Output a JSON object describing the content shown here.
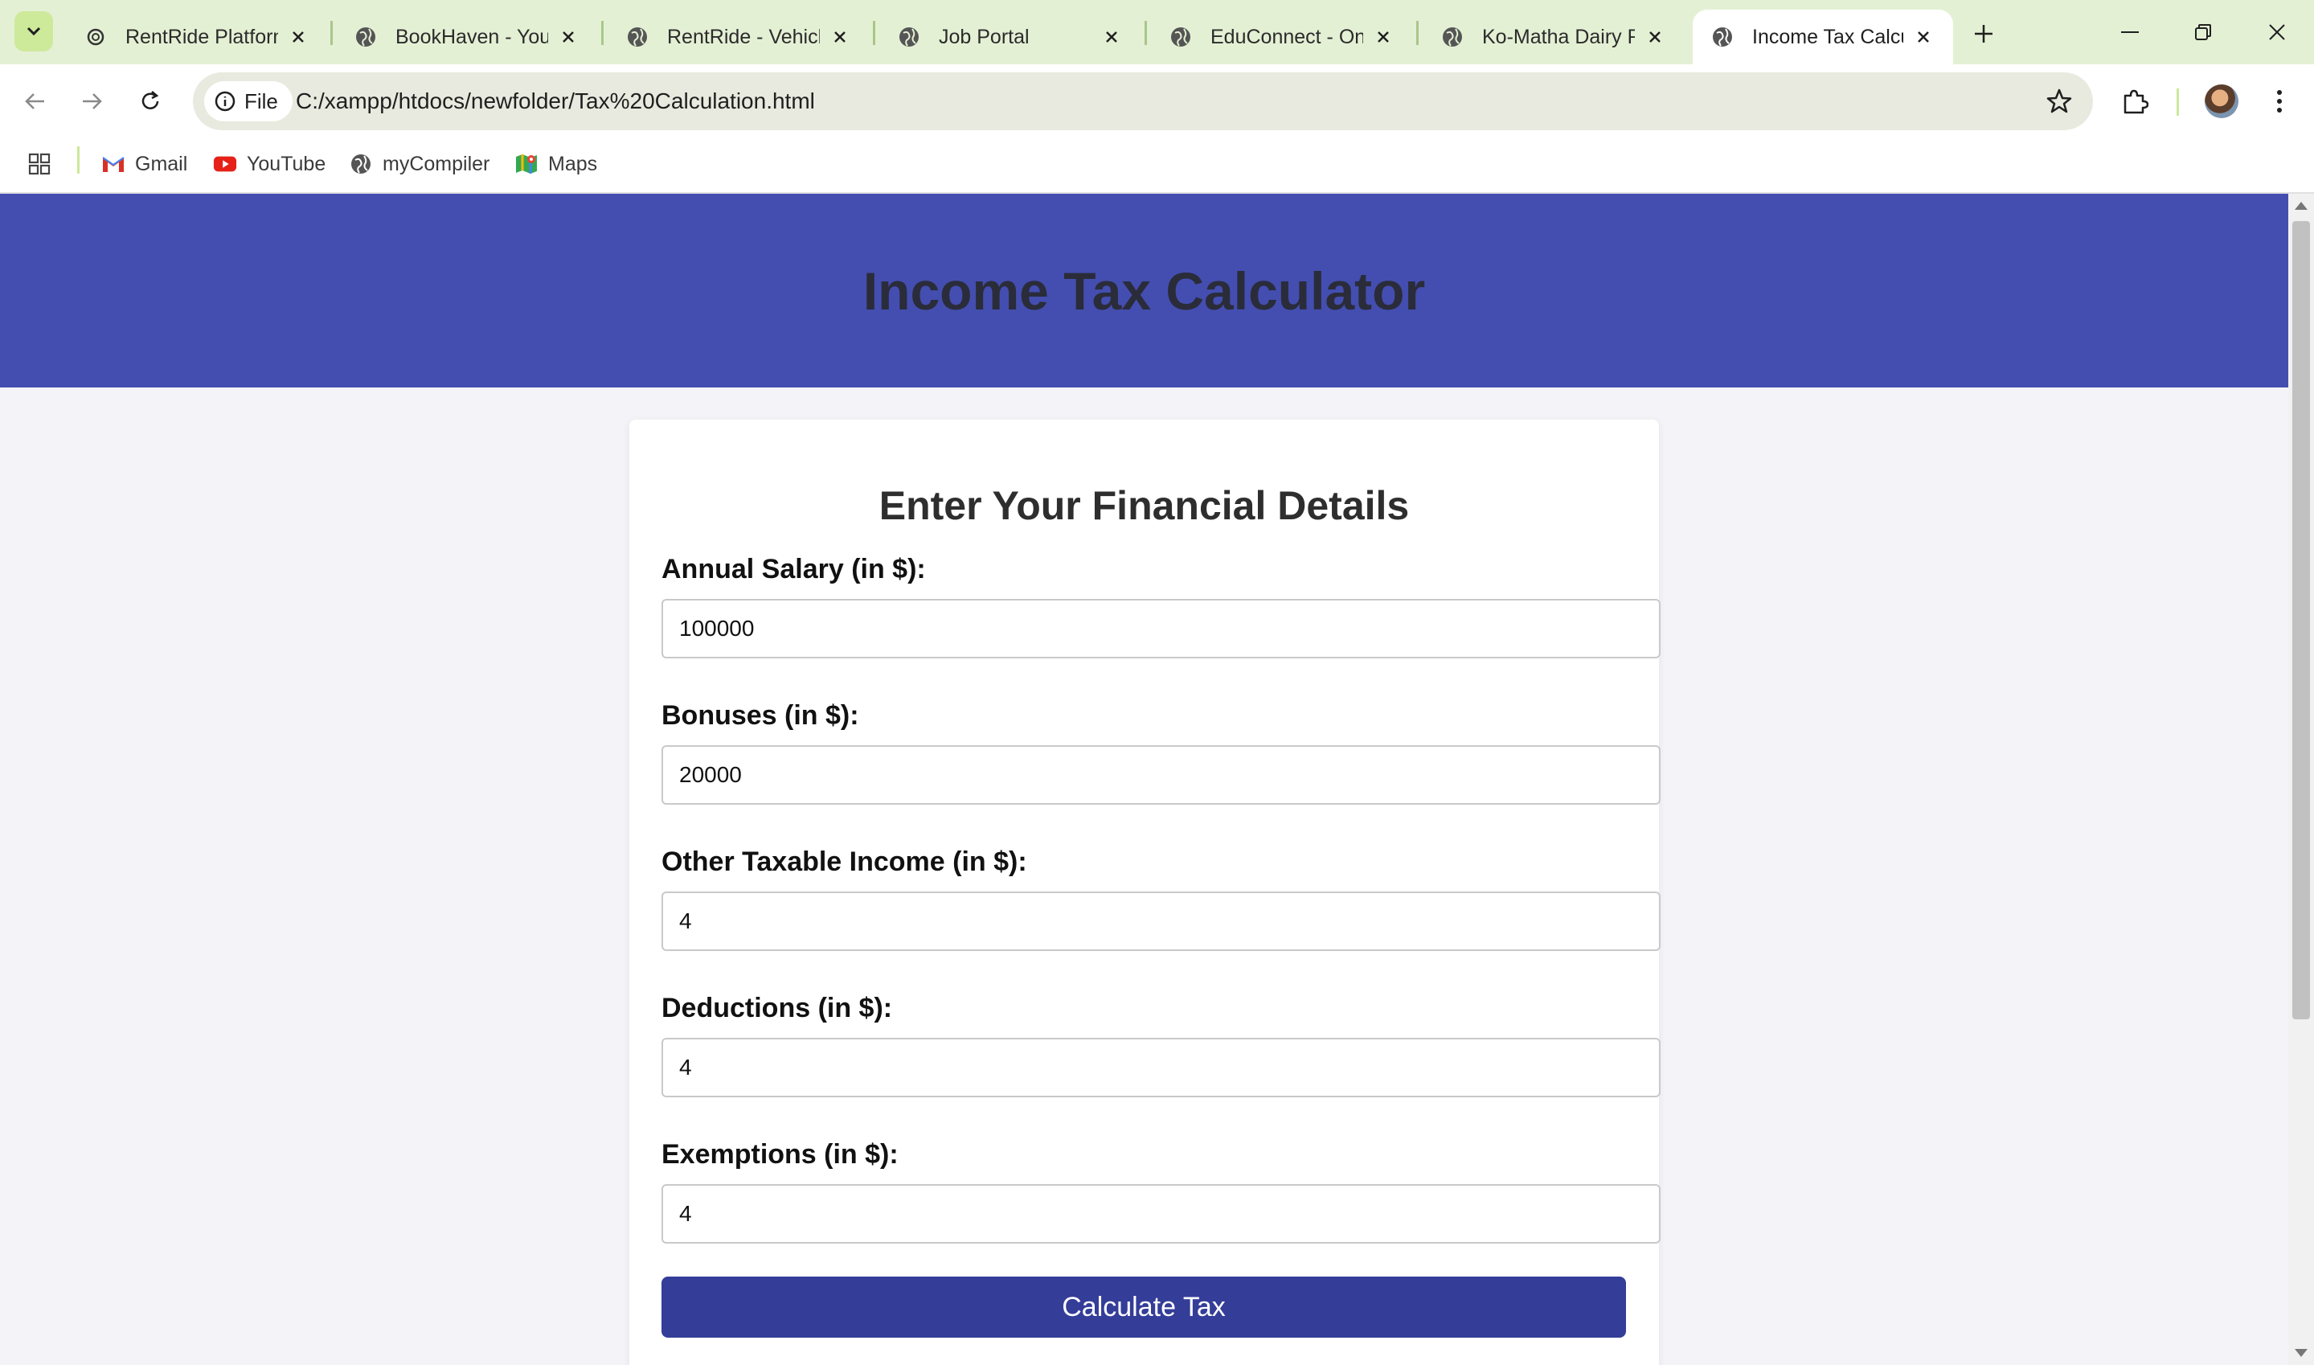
{
  "browser": {
    "tabs": [
      {
        "title": "RentRide Platform",
        "icon": "openai-icon",
        "active": false
      },
      {
        "title": "BookHaven - Your",
        "icon": "globe-icon",
        "active": false
      },
      {
        "title": "RentRide - Vehicle",
        "icon": "globe-icon",
        "active": false
      },
      {
        "title": "Job Portal",
        "icon": "globe-icon",
        "active": false
      },
      {
        "title": "EduConnect - Onli",
        "icon": "globe-icon",
        "active": false
      },
      {
        "title": "Ko-Matha Dairy Fa",
        "icon": "globe-icon",
        "active": false
      },
      {
        "title": "Income Tax Calcul",
        "icon": "globe-icon",
        "active": true
      }
    ],
    "address": {
      "chip_label": "File",
      "url": "C:/xampp/htdocs/newfolder/Tax%20Calculation.html"
    },
    "bookmarks": [
      {
        "label": "Gmail",
        "icon": "gmail-icon"
      },
      {
        "label": "YouTube",
        "icon": "youtube-icon"
      },
      {
        "label": "myCompiler",
        "icon": "globe-icon"
      },
      {
        "label": "Maps",
        "icon": "maps-icon"
      }
    ],
    "colors": {
      "tabstrip": "#e4f0d4",
      "toolbar": "#ffffff"
    }
  },
  "page": {
    "title": "Income Tax Calculator",
    "form": {
      "heading": "Enter Your Financial Details",
      "fields": [
        {
          "label": "Annual Salary (in $):",
          "value": "100000"
        },
        {
          "label": "Bonuses (in $):",
          "value": "20000"
        },
        {
          "label": "Other Taxable Income (in $):",
          "value": "4"
        },
        {
          "label": "Deductions (in $):",
          "value": "4"
        },
        {
          "label": "Exemptions (in $):",
          "value": "4"
        }
      ],
      "submit_label": "Calculate Tax"
    },
    "colors": {
      "header_bg": "#444eb0",
      "button_bg": "#343d98",
      "page_bg": "#f4f4f8"
    }
  }
}
